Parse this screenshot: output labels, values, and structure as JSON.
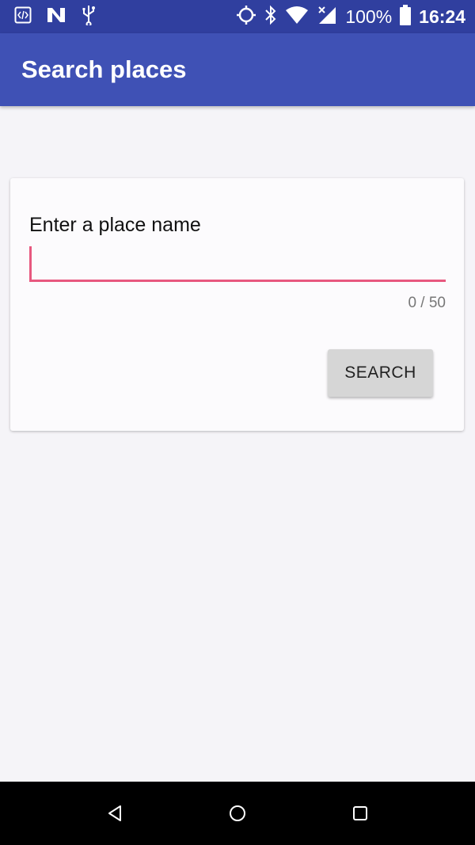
{
  "status_bar": {
    "icons_left": [
      "dev-code-icon",
      "notification-n-icon",
      "usb-icon"
    ],
    "icons_right": [
      "location-icon",
      "bluetooth-icon",
      "wifi-icon",
      "signal-icon",
      "battery-icon"
    ],
    "battery": "100%",
    "time": "16:24"
  },
  "app_bar": {
    "title": "Search places"
  },
  "form": {
    "label": "Enter a place name",
    "value": "",
    "counter": "0 / 50",
    "search_label": "SEARCH"
  },
  "nav_bar": {
    "buttons": [
      "back-icon",
      "home-icon",
      "recents-icon"
    ]
  },
  "colors": {
    "status_bar": "#303f9f",
    "app_bar": "#3f51b5",
    "accent": "#e7587f"
  }
}
